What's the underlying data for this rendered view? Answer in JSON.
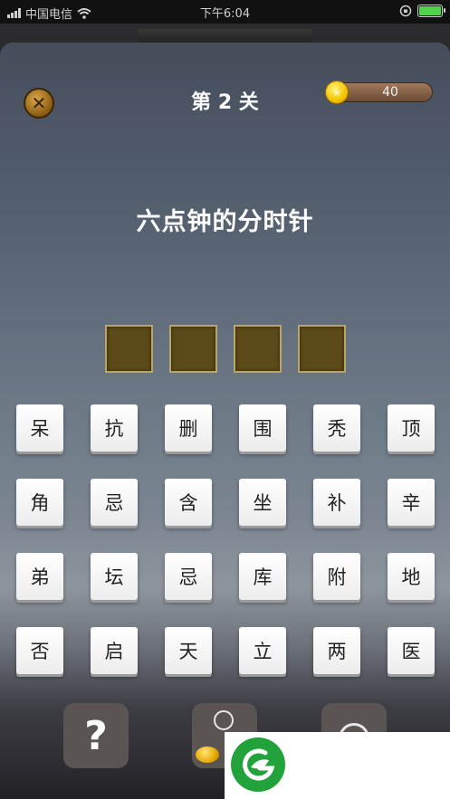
{
  "status_bar": {
    "carrier": "中国电信",
    "time": "下午6:04",
    "icons": [
      "signal-icon",
      "wifi-icon",
      "rotation-lock-icon",
      "battery-icon"
    ]
  },
  "header": {
    "close_icon": "close-icon",
    "level_title": "第 2 关",
    "coins": "40",
    "coin_icon": "star-coin-icon"
  },
  "riddle": "六点钟的分时针",
  "answer_slots": [
    "",
    "",
    "",
    ""
  ],
  "characters": [
    "呆",
    "抗",
    "删",
    "围",
    "秃",
    "顶",
    "角",
    "忌",
    "含",
    "坐",
    "补",
    "辛",
    "弟",
    "坛",
    "忌",
    "库",
    "附",
    "地",
    "否",
    "启",
    "天",
    "立",
    "两",
    "医"
  ],
  "bottom_buttons": {
    "help_label": "?",
    "hint_icon": "lightbulb-icon",
    "share_icon": "circle-icon"
  },
  "colors": {
    "slot_fill": "#5c4a18",
    "coin_gold": "#f5c400",
    "logo_green": "#21a23a"
  }
}
